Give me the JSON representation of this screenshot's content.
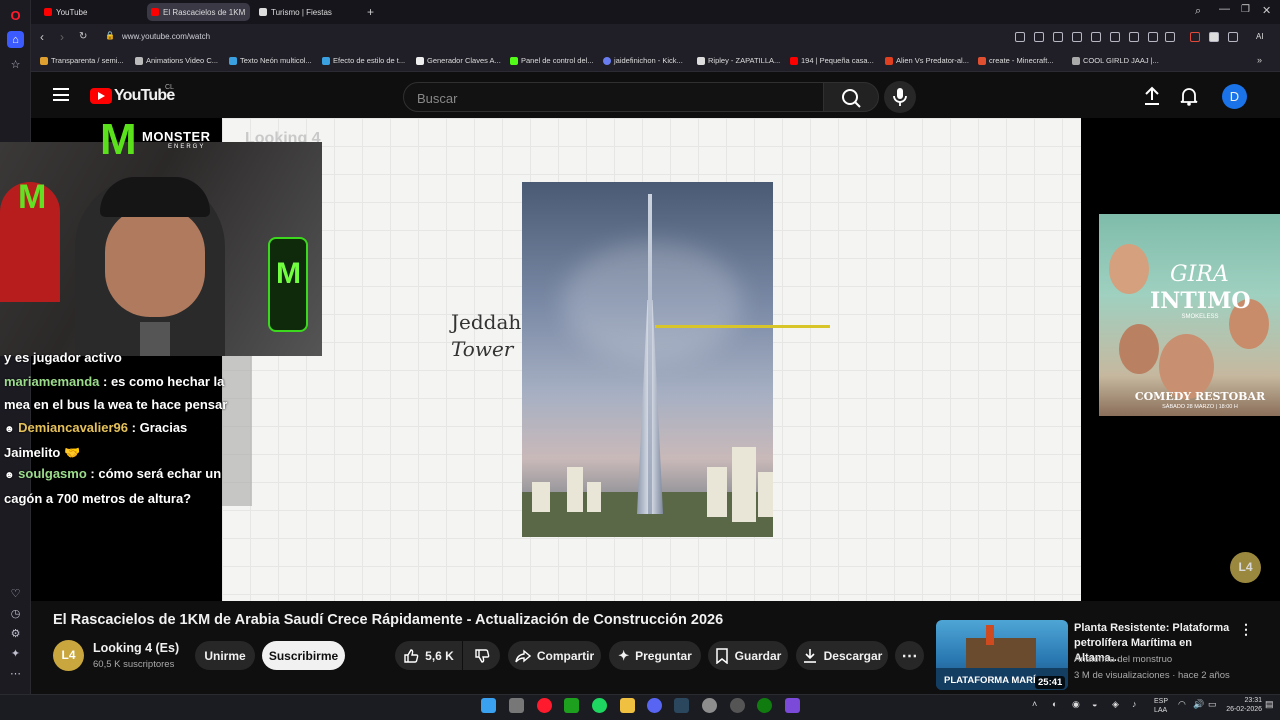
{
  "browser": {
    "tabs": [
      {
        "label": "YouTube",
        "color": "#ff0000"
      },
      {
        "label": "El Rascacielos de 1KM",
        "color": "#ff0000",
        "active": true
      },
      {
        "label": "Turismo | Fiestas",
        "color": "#dddddd"
      }
    ],
    "url": "www.youtube.com/watch",
    "aria_label": "AI",
    "bookmarks": [
      {
        "label": "Transparenta / semi...",
        "color": "#e0a030"
      },
      {
        "label": "Animations Video C...",
        "color": "#bbbbbb"
      },
      {
        "label": "Texto Neón multicol...",
        "color": "#3aa0e0"
      },
      {
        "label": "Efecto de estilo de t...",
        "color": "#3aa0e0"
      },
      {
        "label": "Generador Claves A...",
        "color": "#eeeeee"
      },
      {
        "label": "Panel de control del...",
        "color": "#53fc18"
      },
      {
        "label": "jaidefinichon - Kick...",
        "color": "#6a7df0"
      },
      {
        "label": "Ripley - ZAPATILLA...",
        "color": "#dddddd"
      },
      {
        "label": "194 | Pequeña casa...",
        "color": "#ff0000"
      },
      {
        "label": "Alien Vs Predator-al...",
        "color": "#e04020"
      },
      {
        "label": "create - Minecraft...",
        "color": "#e05030"
      },
      {
        "label": "COOL GIRLD JAAJ |...",
        "color": "#aaaaaa"
      }
    ]
  },
  "youtube": {
    "logo_text": "YouTube",
    "country": "CL",
    "search_placeholder": "Buscar",
    "avatar_letter": "D",
    "video": {
      "title": "El Rascacielos de 1KM de Arabia Saudí Crece Rápidamente - Actualización de Construcción 2026",
      "tower_name_line1": "Jeddah",
      "tower_name_line2": "Tower",
      "watermark_text": "Looking 4",
      "channel_badge": "L4"
    },
    "stream_overlay": {
      "brand_line1": "MONSTER",
      "brand_line2": "ENERGY",
      "chat": [
        {
          "user": "",
          "text": "y es jugador activo"
        },
        {
          "user": "mariamemanda",
          "text": ": es como hechar la mea en el bus la wea te hace pensar"
        },
        {
          "user": "Demiancavalier96",
          "text": ": Gracias Jaimelito 🤝"
        },
        {
          "user": "soulgasmo",
          "text": ": cómo será echar un cagón a 700 metros de altura?"
        }
      ]
    },
    "ad": {
      "line1": "GIRA",
      "line2": "INTIMO",
      "line3": "SMOKELESS",
      "line4": "COMEDY RESTOBAR",
      "line5": "SÁBADO 28 MARZO | 18:00 H"
    },
    "channel": {
      "avatar": "L4",
      "name": "Looking 4 (Es)",
      "subscribers": "60,5 K suscriptores",
      "join_label": "Unirme",
      "subscribe_label": "Suscribirme"
    },
    "actions": {
      "likes": "5,6 K",
      "share": "Compartir",
      "ask": "Preguntar",
      "save": "Guardar",
      "download": "Descargar"
    },
    "recommended": {
      "title": "Planta Resistente: Plataforma petrolífera Marítima en Altama...",
      "channel": "Anatomía del monstruo",
      "meta": "3 M de visualizaciones · hace 2 años",
      "thumb_text": "PLATAFORMA MARÍ",
      "duration": "25:41"
    }
  },
  "taskbar": {
    "lang_line1": "ESP",
    "lang_line2": "LAA",
    "time": "23:31",
    "date": "26-02-2026"
  }
}
